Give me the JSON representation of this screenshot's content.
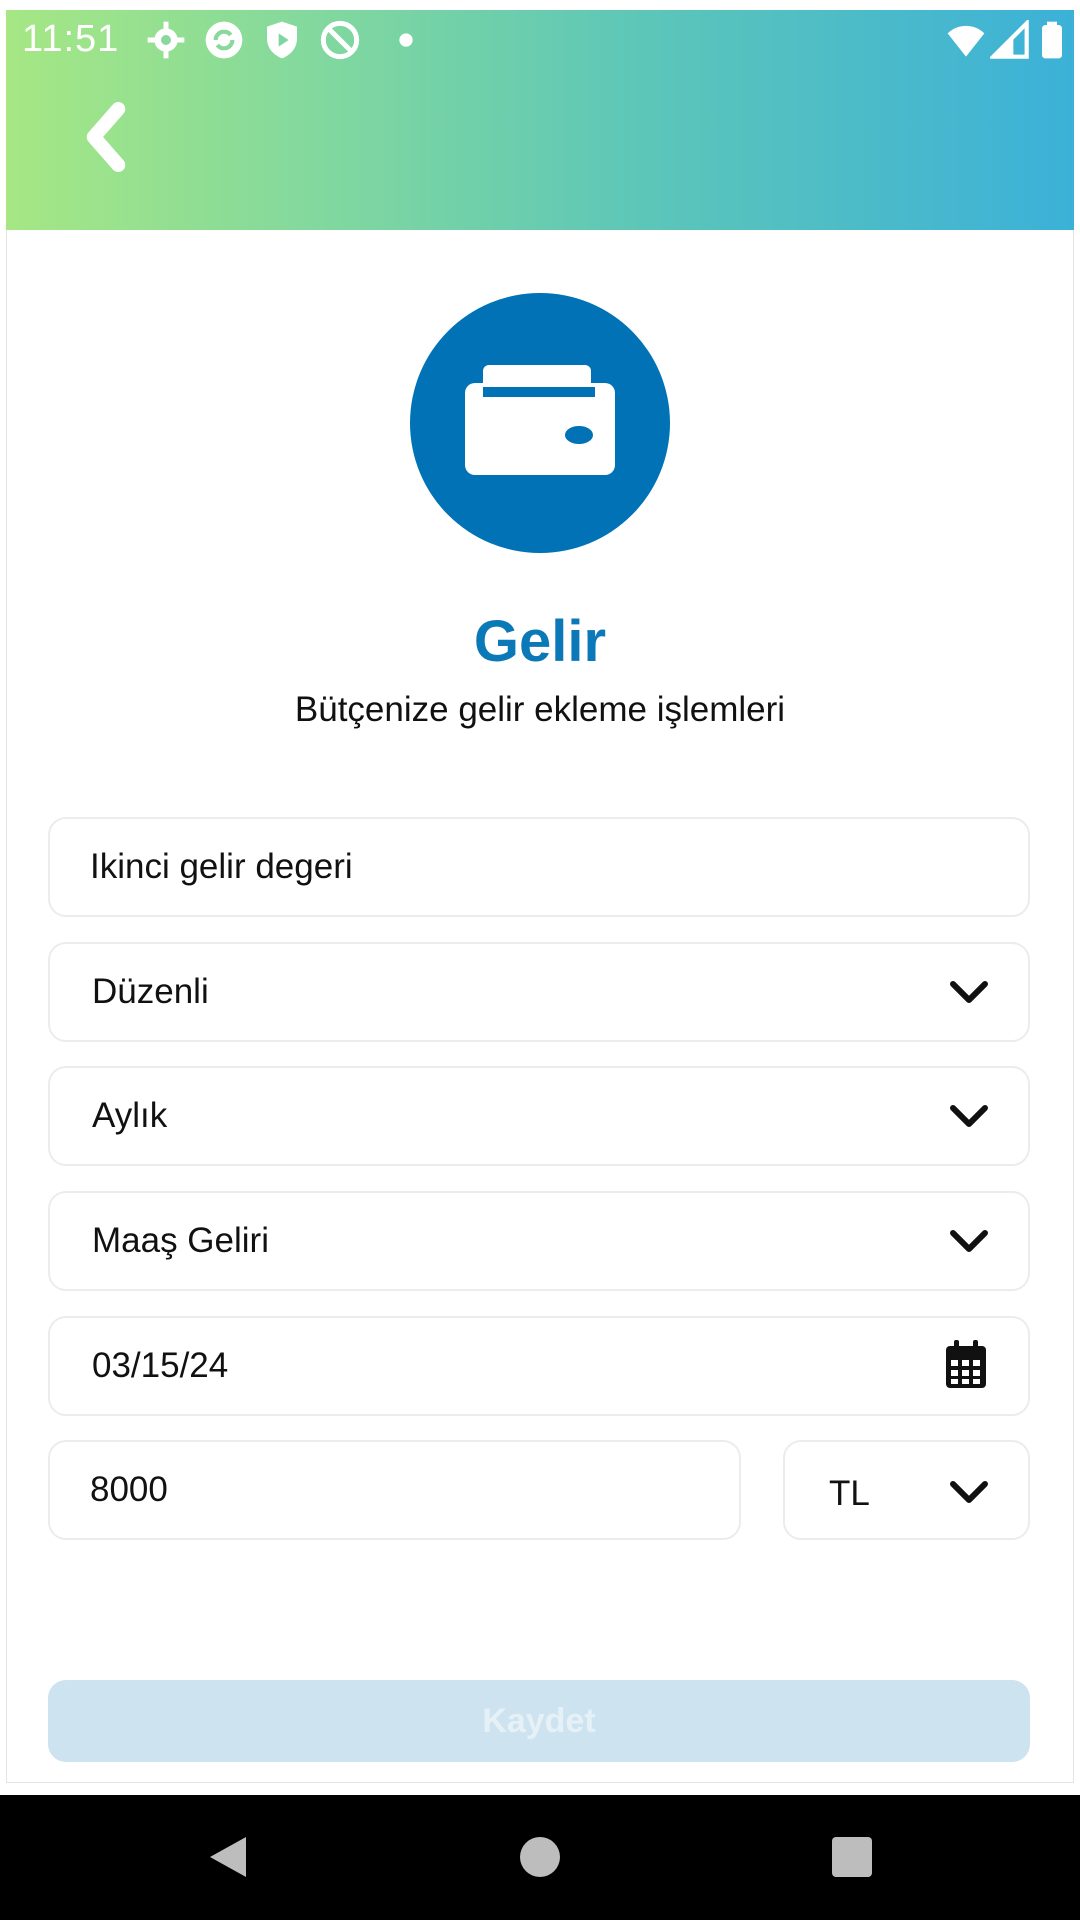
{
  "statusbar": {
    "time": "11:51"
  },
  "header": {
    "back_icon": "chevron-left-icon"
  },
  "hero": {
    "icon": "wallet-icon",
    "circle_color": "#0072b5"
  },
  "page": {
    "title": "Gelir",
    "subtitle": "Bütçenize gelir ekleme işlemleri"
  },
  "form": {
    "name_value": "Ikinci gelir degeri",
    "type_value": "Düzenli",
    "frequency_value": "Aylık",
    "category_value": "Maaş Geliri",
    "date_value": "03/15/24",
    "amount_value": "8000",
    "currency_value": "TL"
  },
  "actions": {
    "save_label": "Kaydet"
  },
  "colors": {
    "accent": "#0b78b8",
    "header_gradient_start": "#a6e784",
    "header_gradient_end": "#3cb1d8",
    "save_disabled_bg": "#cde3ef"
  }
}
